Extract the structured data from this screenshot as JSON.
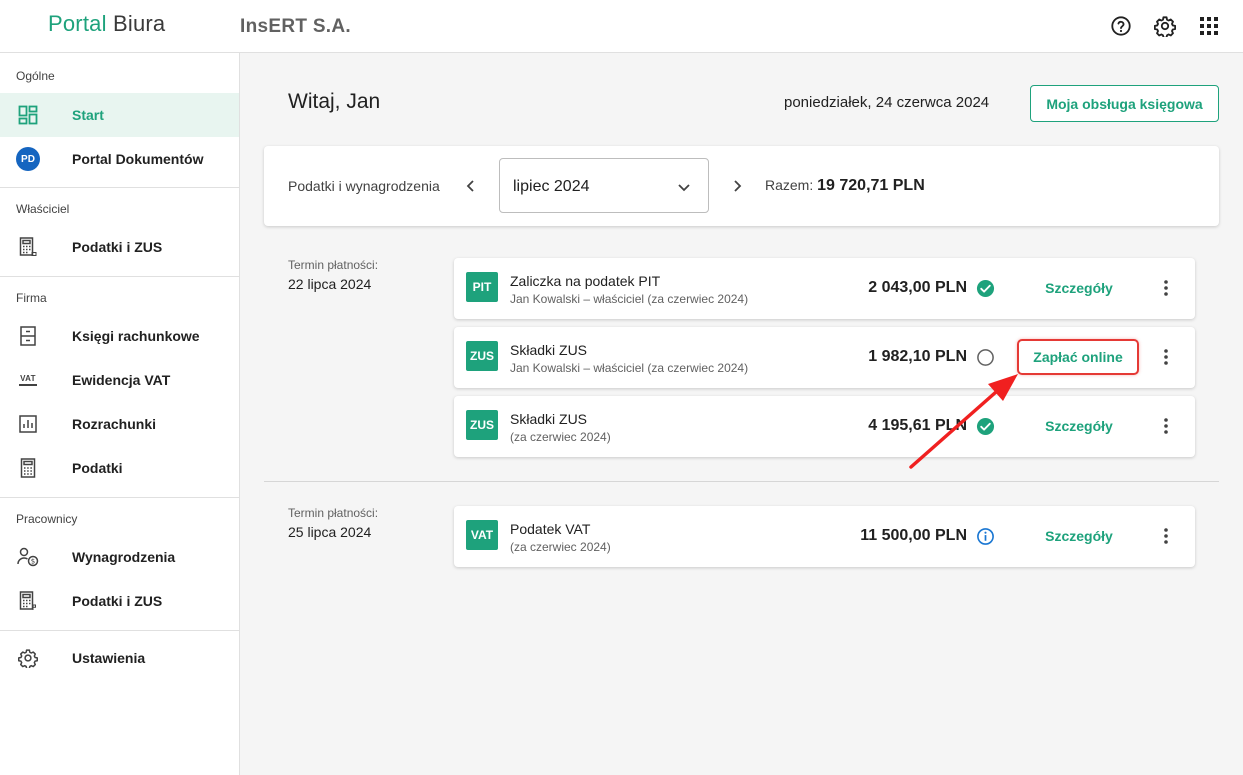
{
  "header": {
    "logo_part1": "Portal",
    "logo_part2": "Biura",
    "company": "InsERT S.A."
  },
  "sidebar": {
    "sections": [
      {
        "title": "Ogólne"
      },
      {
        "title": "Właściciel"
      },
      {
        "title": "Firma"
      },
      {
        "title": "Pracownicy"
      }
    ],
    "items": [
      {
        "label": "Start",
        "icon": "dashboard-icon"
      },
      {
        "label": "Portal Dokumentów",
        "icon": "pd-badge-icon",
        "badge": "PD"
      },
      {
        "label": "Podatki i ZUS",
        "icon": "calculator-icon"
      },
      {
        "label": "Księgi rachunkowe",
        "icon": "ledger-icon"
      },
      {
        "label": "Ewidencja VAT",
        "icon": "vat-icon",
        "badge": "VAT"
      },
      {
        "label": "Rozrachunki",
        "icon": "bar-chart-icon"
      },
      {
        "label": "Podatki",
        "icon": "calculator-icon"
      },
      {
        "label": "Wynagrodzenia",
        "icon": "user-money-icon"
      },
      {
        "label": "Podatki i ZUS",
        "icon": "calculator-icon"
      },
      {
        "label": "Ustawienia",
        "icon": "gear-icon"
      }
    ]
  },
  "main": {
    "greeting": "Witaj, Jan",
    "date": "poniedziałek, 24 czerwca 2024",
    "accounting_button": "Moja obsługa księgowa",
    "filter": {
      "label": "Podatki i wynagrodzenia",
      "period": "lipiec 2024",
      "total_label": "Razem:",
      "total_value": "19 720,71 PLN"
    },
    "groups": [
      {
        "term_label": "Termin płatności:",
        "term_date": "22 lipca 2024",
        "items": [
          {
            "badge": "PIT",
            "title": "Zaliczka na podatek PIT",
            "subtitle": "Jan Kowalski – właściciel (za czerwiec 2024)",
            "amount": "2 043,00 PLN",
            "status": "paid",
            "action": "Szczegóły"
          },
          {
            "badge": "ZUS",
            "title": "Składki ZUS",
            "subtitle": "Jan Kowalski – właściciel (za czerwiec 2024)",
            "amount": "1 982,10 PLN",
            "status": "unpaid",
            "action": "Zapłać online"
          },
          {
            "badge": "ZUS",
            "title": "Składki ZUS",
            "subtitle": "(za czerwiec 2024)",
            "amount": "4 195,61 PLN",
            "status": "paid",
            "action": "Szczegóły"
          }
        ]
      },
      {
        "term_label": "Termin płatności:",
        "term_date": "25 lipca 2024",
        "items": [
          {
            "badge": "VAT",
            "title": "Podatek VAT",
            "subtitle": "(za czerwiec 2024)",
            "amount": "11 500,00 PLN",
            "status": "info",
            "action": "Szczegóły"
          }
        ]
      }
    ]
  },
  "colors": {
    "brand": "#1ea27c",
    "highlight": "#e53935",
    "info": "#1976d2"
  }
}
